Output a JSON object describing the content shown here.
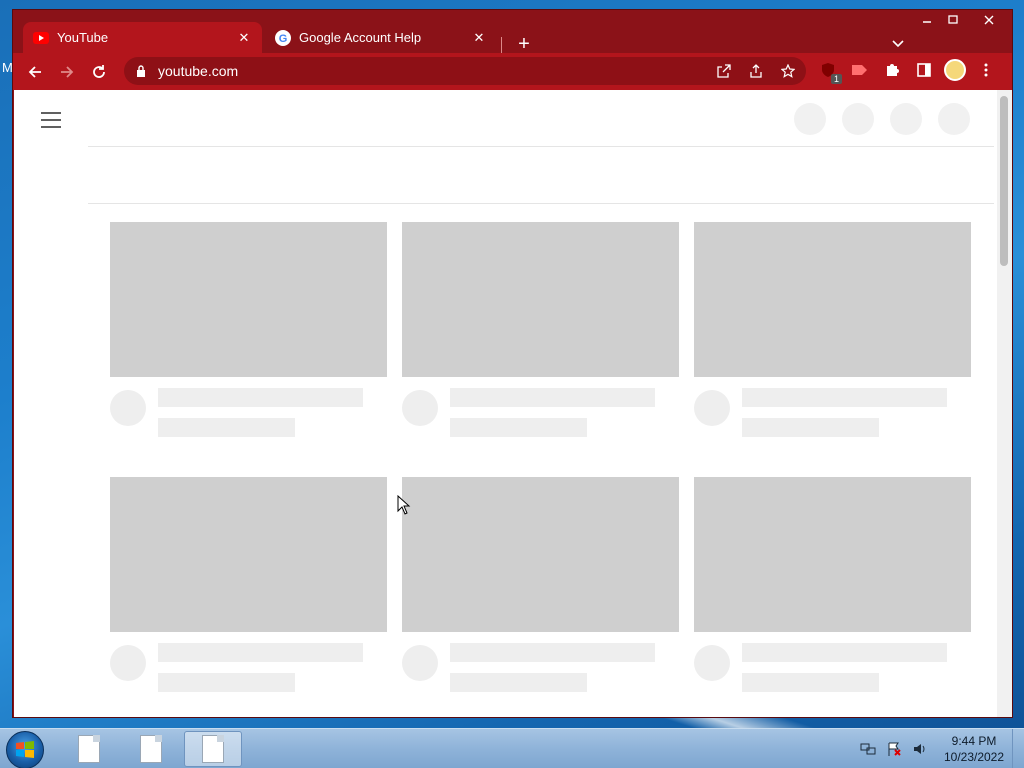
{
  "desktop": {
    "stray_text": "M"
  },
  "browser": {
    "tabs": [
      {
        "title": "YouTube",
        "favicon": "youtube-favicon",
        "active": true
      },
      {
        "title": "Google Account Help",
        "favicon": "google-favicon",
        "active": false
      }
    ],
    "new_tab_label": "+",
    "address": {
      "url": "youtube.com"
    },
    "extensions": {
      "ublock_count": "1"
    }
  },
  "page": {
    "header_placeholders": 4,
    "cards": 6
  },
  "taskbar": {
    "items": [
      "document",
      "document",
      "document"
    ],
    "clock": {
      "time": "9:44 PM",
      "date": "10/23/2022"
    }
  }
}
